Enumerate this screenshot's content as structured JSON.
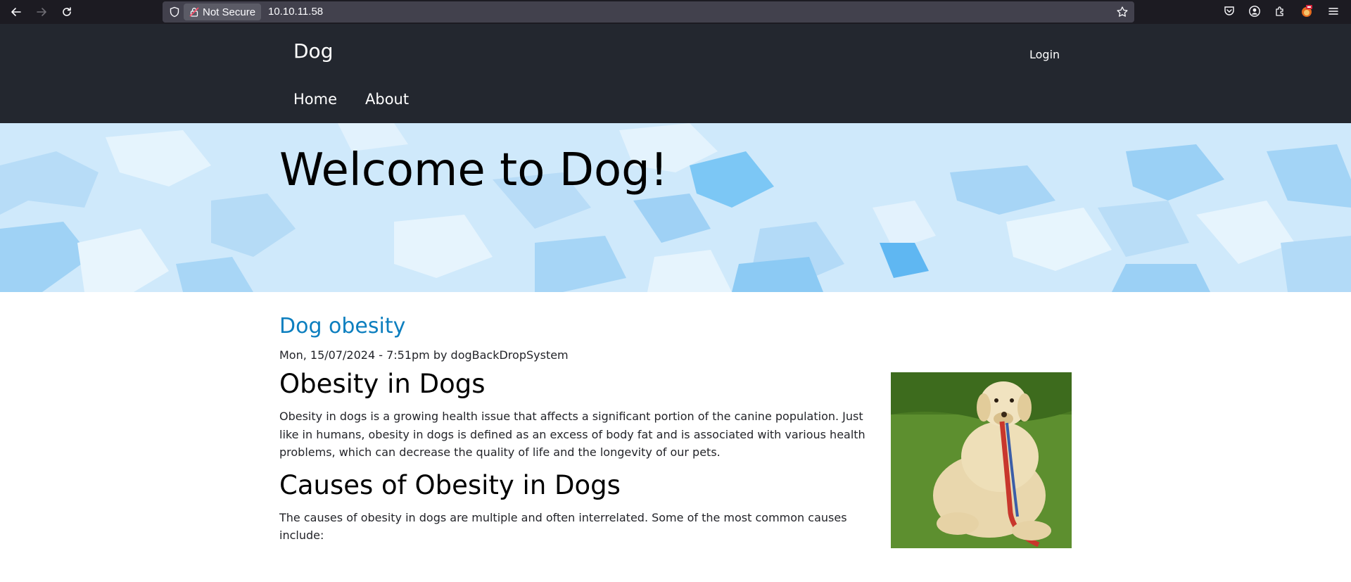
{
  "browser": {
    "security_label": "Not Secure",
    "url": "10.10.11.58"
  },
  "site": {
    "name": "Dog",
    "login": "Login",
    "nav": [
      "Home",
      "About"
    ]
  },
  "hero": {
    "title": "Welcome to Dog!"
  },
  "article": {
    "title": "Dog obesity",
    "meta": "Mon, 15/07/2024 - 7:51pm by dogBackDropSystem",
    "heading1": "Obesity in Dogs",
    "paragraph1": "Obesity in dogs is a growing health issue that affects a significant portion of the canine population. Just like in humans, obesity in dogs is defined as an excess of body fat and is associated with various health problems, which can decrease the quality of life and the longevity of our pets.",
    "heading2": "Causes of Obesity in Dogs",
    "paragraph2": "The causes of obesity in dogs are multiple and often interrelated. Some of the most common causes include:"
  },
  "colors": {
    "header_bg": "#23272f",
    "link": "#0d7fbf",
    "hero_bg": "#cfe9fb"
  }
}
